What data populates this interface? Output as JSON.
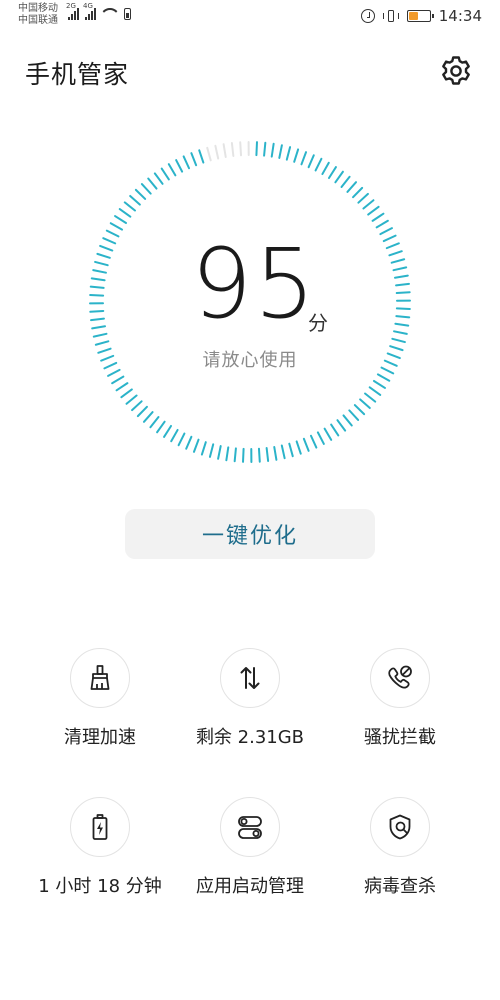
{
  "status_bar": {
    "carrier_1": "中国移动",
    "carrier_2": "中国联通",
    "sim1_network": "2G",
    "sim2_network": "4G",
    "time": "14:34",
    "battery_color": "#f19a2b",
    "icons": [
      "signal-icon",
      "wifi-icon",
      "alarm-icon",
      "vibrate-icon",
      "battery-icon"
    ]
  },
  "header": {
    "title": "手机管家",
    "settings_icon": "gear-icon"
  },
  "score": {
    "value": "95",
    "unit": "分",
    "status": "请放心使用",
    "ring_color": "#2bb3c9",
    "fraction": 0.95
  },
  "optimize_button": {
    "label": "一键优化",
    "color": "#1f6d8c"
  },
  "tools": [
    {
      "icon": "broom-icon",
      "label": "清理加速"
    },
    {
      "icon": "transfer-arrows-icon",
      "label": "剩余 2.31GB"
    },
    {
      "icon": "blocked-call-icon",
      "label": "骚扰拦截"
    },
    {
      "icon": "battery-icon",
      "label": "1 小时 18 分钟"
    },
    {
      "icon": "toggle-icon",
      "label": "应用启动管理"
    },
    {
      "icon": "shield-search-icon",
      "label": "病毒查杀"
    }
  ]
}
